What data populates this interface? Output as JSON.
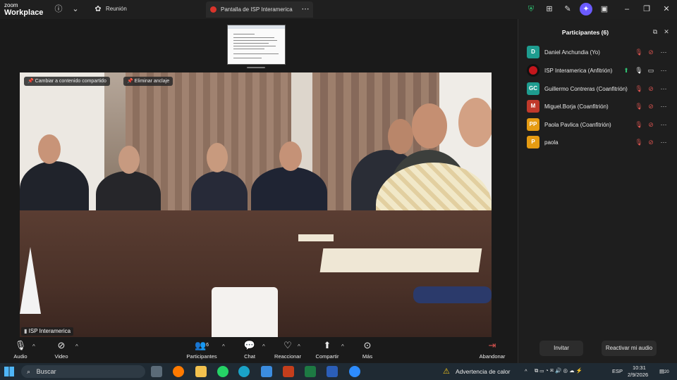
{
  "titlebar": {
    "brand_top": "zoom",
    "brand_bottom": "Workplace",
    "meeting_label": "Reunión",
    "tab_label": "Pantalla de ISP Interamerica"
  },
  "video": {
    "change_content_label": "Cambiar a contenido compartido",
    "unpin_label": "Eliminar anclaje",
    "speaker_name": "ISP Interamerica"
  },
  "participants": {
    "title": "Participantes (6)",
    "items": [
      {
        "initials": "D",
        "name": "Daniel Anchundia (Yo)",
        "color": "#1e9c8f"
      },
      {
        "initials": "",
        "name": "ISP Interamerica (Anfitrión)",
        "color": "#c4161c"
      },
      {
        "initials": "GC",
        "name": "Guillermo Contreras (Coanfitrión)",
        "color": "#1e9c8f"
      },
      {
        "initials": "M",
        "name": "Miguel.Borja (Coanfitrión)",
        "color": "#c0392b"
      },
      {
        "initials": "PP",
        "name": "Paola Pavlica (Coanfitrión)",
        "color": "#e59b12"
      },
      {
        "initials": "P",
        "name": "paola",
        "color": "#e59b12"
      }
    ],
    "invite_label": "Invitar",
    "unmute_label": "Reactivar mi audio"
  },
  "toolbar": {
    "audio": "Audio",
    "video": "Video",
    "participants": "Participantes",
    "participants_count": "6",
    "chat": "Chat",
    "react": "Reaccionar",
    "share": "Compartir",
    "more": "Más",
    "leave": "Abandonar"
  },
  "taskbar": {
    "search_label": "Buscar",
    "weather_label": "Advertencia de calor",
    "language": "ESP",
    "time": "10:31",
    "date": "2/9/2026",
    "notifications": "20"
  },
  "colors": {
    "accent_red": "#d9534f",
    "share_green": "#2fbf71"
  }
}
